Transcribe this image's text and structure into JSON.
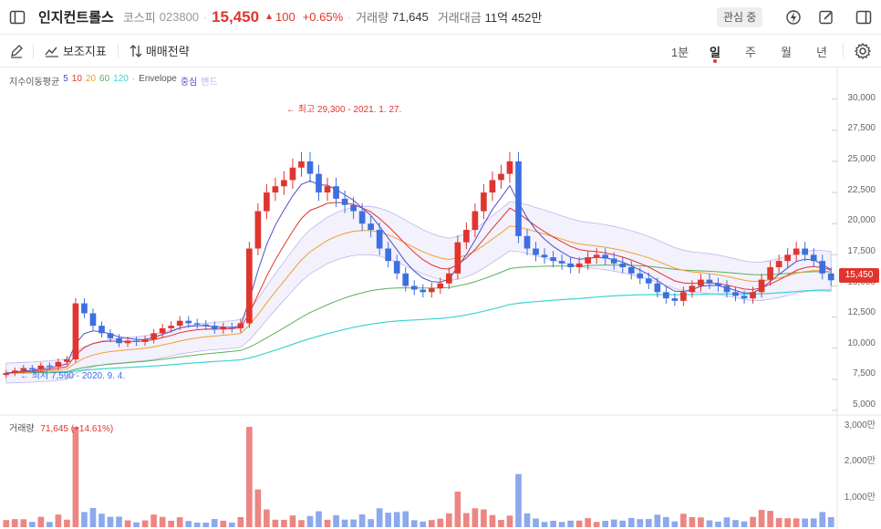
{
  "header": {
    "stock_name": "인지컨트롤스",
    "market": "코스피",
    "code": "023800",
    "price": "15,450",
    "change": "100",
    "change_pct": "+0.65%",
    "volume_label": "거래량",
    "volume": "71,645",
    "amount_label": "거래대금",
    "amount": "11억 452만",
    "watch_label": "관심 중"
  },
  "toolbar": {
    "indicator_label": "보조지표",
    "strategy_label": "매매전략",
    "periods": [
      "1분",
      "일",
      "주",
      "월",
      "년"
    ],
    "active_period": "일"
  },
  "legend": {
    "ma_label": "지수이동평균",
    "ma_values": [
      "5",
      "10",
      "20",
      "60",
      "120"
    ],
    "separator": "·",
    "envelope": "Envelope",
    "envelope_center": "중심",
    "envelope_band": "밴드"
  },
  "annotations": {
    "high": "최고 29,300 - 2021. 1. 27.",
    "low": "최저 7,590 - 2020. 9. 4."
  },
  "price_tag": "15,450",
  "y_axis_labels": [
    "30,000",
    "27,500",
    "25,000",
    "22,500",
    "20,000",
    "17,500",
    "15,000",
    "12,500",
    "10,000",
    "7,500",
    "5,000"
  ],
  "volume_panel": {
    "label": "거래량",
    "value": "71,645",
    "pct": "(+14.61%)",
    "axis_labels": [
      "3,000만",
      "2,000만",
      "1,000만"
    ]
  },
  "colors": {
    "up": "#e0352f",
    "down": "#3d6fe0",
    "ma5": "#4e4ec8",
    "ma10": "#e0352f",
    "ma20": "#f0a030",
    "ma60": "#5bb05b",
    "ma120": "#3cd4d4",
    "envelope": "#b7b0ee"
  },
  "chart_data": {
    "type": "candlestick",
    "y_range": [
      5000,
      31000
    ],
    "series_closes": [
      8000,
      8200,
      8400,
      8300,
      8600,
      8500,
      8900,
      9100,
      13600,
      12800,
      11800,
      11200,
      10800,
      10400,
      10600,
      10500,
      10700,
      11200,
      11600,
      11800,
      12200,
      12000,
      11900,
      11800,
      11500,
      11700,
      11600,
      12000,
      18000,
      21000,
      22500,
      23000,
      23500,
      24500,
      25000,
      24000,
      22500,
      23000,
      22000,
      21500,
      21000,
      20000,
      19500,
      18000,
      17000,
      16000,
      15000,
      14700,
      14500,
      14800,
      15200,
      16000,
      18500,
      19500,
      21000,
      22500,
      23500,
      24000,
      25000,
      19000,
      18000,
      17500,
      17300,
      17000,
      16800,
      16500,
      16800,
      17300,
      17500,
      17200,
      16800,
      16500,
      16000,
      15600,
      15200,
      14500,
      14000,
      13800,
      14500,
      15000,
      15500,
      15200,
      15000,
      14500,
      14200,
      14000,
      14500,
      15500,
      16500,
      17000,
      17500,
      18000,
      17500,
      17000,
      16000,
      15450
    ],
    "volume_axis": [
      "3,000만",
      "2,000만",
      "1,000만"
    ]
  }
}
